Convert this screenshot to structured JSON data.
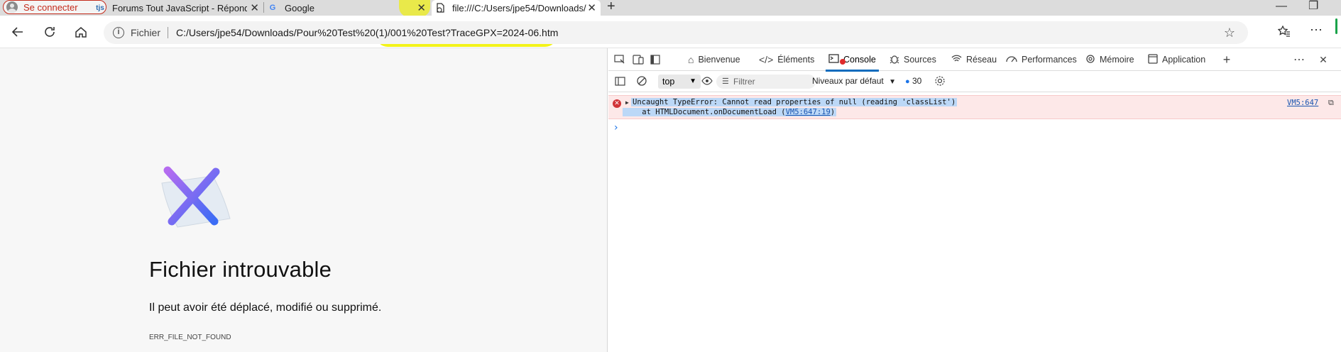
{
  "browser": {
    "profile": {
      "label": "Se connecter"
    },
    "tabs": [
      {
        "title": "Forums Tout JavaScript - Répondre",
        "favicon": "tjs",
        "active": false
      },
      {
        "title": "Google",
        "favicon": "G",
        "active": false
      },
      {
        "title": "file:///C:/Users/jpe54/Downloads/",
        "favicon": "file-error-icon",
        "active": true
      }
    ],
    "tab_close": "✕",
    "new_tab": "+",
    "window_controls": {
      "minimize": "—",
      "restore": "❐"
    },
    "address": {
      "scheme_label": "Fichier",
      "url": "C:/Users/jpe54/Downloads/Pour%20Test%20(1)/001%20Test?TraceGPX=2024-06.htm"
    }
  },
  "page": {
    "title": "Fichier introuvable",
    "subtitle": "Il peut avoir été déplacé, modifié ou supprimé.",
    "error_code": "ERR_FILE_NOT_FOUND"
  },
  "devtools": {
    "tabs": [
      {
        "label": "Bienvenue",
        "icon": "home-icon"
      },
      {
        "label": "Éléments",
        "icon": "code-icon"
      },
      {
        "label": "Console",
        "icon": "console-icon",
        "active": true
      },
      {
        "label": "Sources",
        "icon": "bug-icon"
      },
      {
        "label": "Réseau",
        "icon": "wifi-icon"
      },
      {
        "label": "Performances",
        "icon": "performance-icon"
      },
      {
        "label": "Mémoire",
        "icon": "memory-icon"
      },
      {
        "label": "Application",
        "icon": "application-icon"
      }
    ],
    "filterbar": {
      "context": "top",
      "filter_placeholder": "Filtrer",
      "levels": "Niveaux par défaut",
      "issues_count": "30"
    },
    "console": {
      "error_line1": "Uncaught TypeError: Cannot read properties of null (reading 'classList')",
      "error_line2_prefix": "    at HTMLDocument.onDocumentLoad (",
      "error_line2_link": "VM5:647:19",
      "error_line2_suffix": ")",
      "source": "VM5:647"
    }
  },
  "colors": {
    "highlight": "#f3f31a",
    "error_bg": "#fde8e8",
    "accent": "#0f6cbd"
  }
}
